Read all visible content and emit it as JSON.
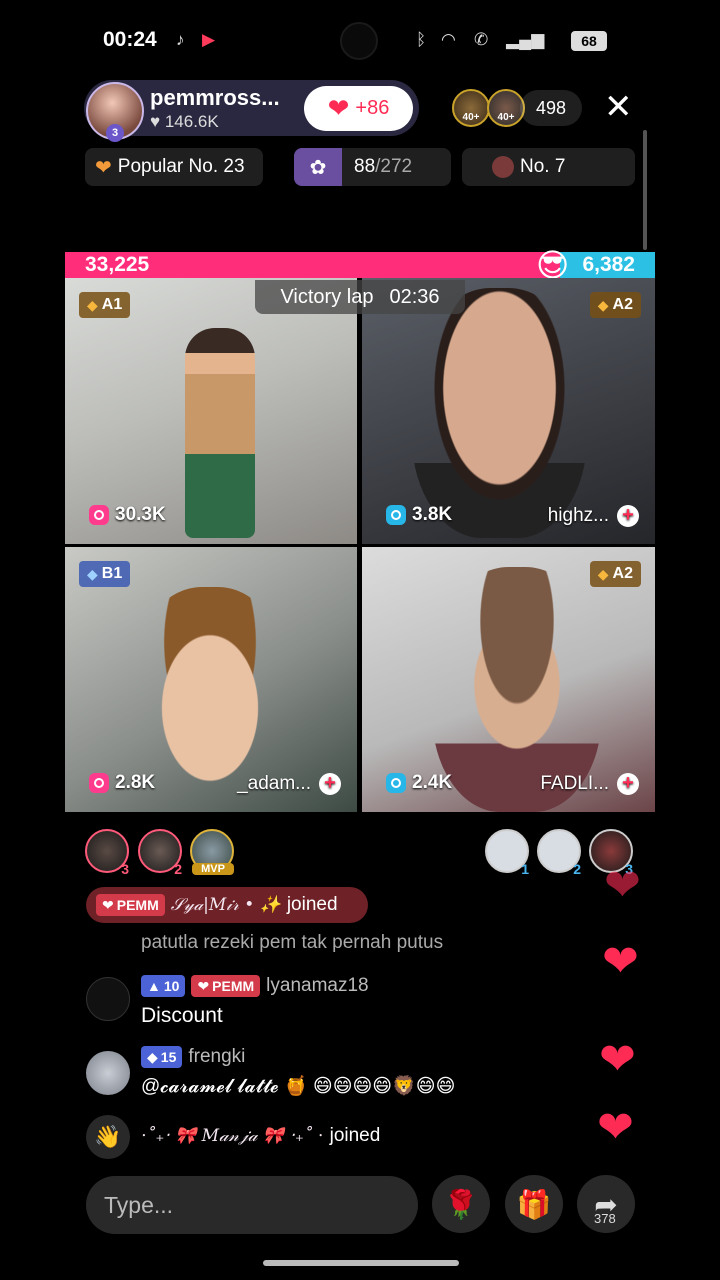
{
  "status_bar": {
    "time": "00:24",
    "battery": "68",
    "icons": [
      "tiktok-icon",
      "record-icon",
      "bluetooth-icon",
      "wifi-icon",
      "call-icon",
      "signal-icon"
    ]
  },
  "host": {
    "name": "pemmross...",
    "likes": "146.6K",
    "level": "3",
    "follow_count": "+86"
  },
  "viewers": {
    "avatars": [
      {
        "label": "40+"
      },
      {
        "label": "40+"
      }
    ],
    "count": "498"
  },
  "chips": {
    "popular": "Popular No. 23",
    "progress_current": "88",
    "progress_total": "/272",
    "rank": "No. 7"
  },
  "battle": {
    "left_score": "33,225",
    "right_score": "6,382",
    "left_share": 0.839,
    "timer_label": "Victory lap",
    "timer_value": "02:36"
  },
  "tiles": [
    {
      "badge": "A1",
      "score": "30.3K",
      "name": ""
    },
    {
      "badge": "A2",
      "score": "3.8K",
      "name": "highz..."
    },
    {
      "badge": "B1",
      "score": "2.8K",
      "name": "_adam..."
    },
    {
      "badge": "A2",
      "score": "2.4K",
      "name": "FADLI..."
    }
  ],
  "contributors_left": [
    {
      "rank": "3"
    },
    {
      "rank": "2"
    },
    {
      "rank": "MVP"
    }
  ],
  "contributors_right": [
    {
      "rank": "1"
    },
    {
      "rank": "2"
    },
    {
      "rank": "3"
    }
  ],
  "chat": {
    "joined_top": {
      "tag": "PEMM",
      "user": "𝒮𝓎𝒶|𝑀𝒾𝓇 • ✨",
      "text": "joined"
    },
    "faded_message": "patutla rezeki pem tak pernah putus",
    "messages": [
      {
        "level": "10",
        "tag": "PEMM",
        "user": "lyanamaz18",
        "text": "Discount"
      },
      {
        "level": "15",
        "tag": "",
        "user": "frengki",
        "text": "@𝓬𝓪𝓻𝓪𝓶𝓮𝓵 𝓵𝓪𝓽𝓽𝓮 🍯 😄😄😄😄🦁😄😄"
      }
    ],
    "joined_bottom": {
      "user": "⋅˚₊‧ 🎀 𝑀𝒶𝓃𝒿𝒶 🎀 ‧₊˚ ⋅",
      "text": "joined"
    }
  },
  "bottom_bar": {
    "input_placeholder": "Type...",
    "share_count": "378"
  },
  "colors": {
    "accent": "#fe2c55",
    "battle_left": "#ff2d7a",
    "battle_right": "#2bc0e4"
  }
}
